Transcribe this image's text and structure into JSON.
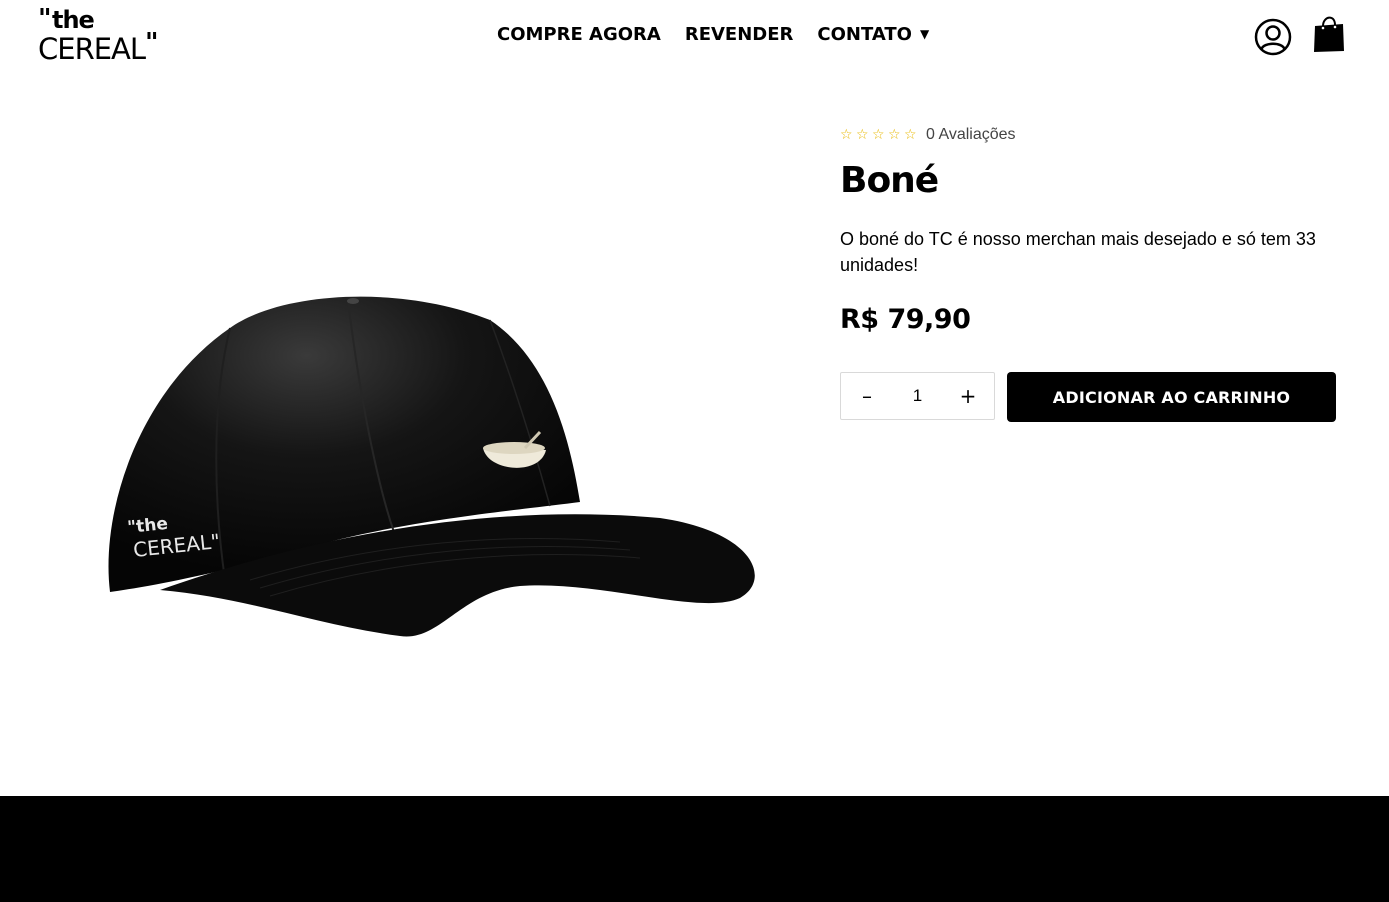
{
  "header": {
    "logo": {
      "top_text": "the",
      "bottom_text": "CEREAL",
      "quote_open": "\"",
      "quote_close": "\""
    },
    "nav": [
      {
        "label": "COMPRE AGORA"
      },
      {
        "label": "REVENDER"
      },
      {
        "label": "CONTATO",
        "has_dropdown": true
      }
    ],
    "icons": [
      "user-account-icon",
      "shopping-bag-icon"
    ]
  },
  "product": {
    "rating": {
      "stars": 0,
      "max_stars": 5,
      "reviews_label": "0 Avaliações"
    },
    "title": "Boné",
    "description": "O boné do TC é nosso merchan mais desejado e só tem 33 unidades!",
    "price": "R$ 79,90",
    "quantity": "1",
    "add_to_cart_label": "ADICIONAR AO CARRINHO",
    "image": {
      "alt": "Boné preto",
      "embroidery_top": "\"the",
      "embroidery_bottom": "CEREAL\""
    }
  },
  "colors": {
    "accent": "#000000",
    "star": "#e8b800",
    "footer": "#000000"
  }
}
